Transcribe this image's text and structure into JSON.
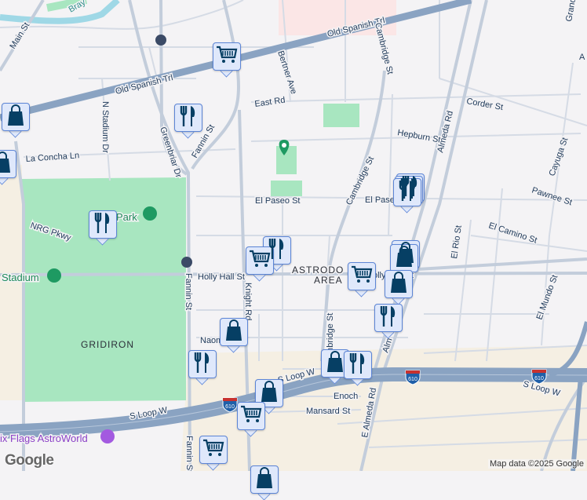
{
  "map": {
    "streets": {
      "main": "Main St",
      "bray": "Bray",
      "old_spanish_trl": "Old Spanish Trl",
      "old_spanish_trl_2": "Old Spanish Trl",
      "n_stadium": "N Stadium Dr",
      "greenbriar": "Greenbriar Dr",
      "fannin_1": "Fannin St",
      "fannin_2": "Fannin St",
      "fannin_3": "Fannin St",
      "bertner": "Bertner Ave",
      "east_rd": "East Rd",
      "cambridge_1": "Cambridge St",
      "cambridge_2": "Cambridge St",
      "cambridge_3": "Cambridge St",
      "corder": "Corder St",
      "hepburn": "Hepburn St",
      "almeda": "Almeda Rd",
      "almeda_2": "Alm",
      "e_almeda": "E Almeda Rd",
      "la_concha": "La Concha Ln",
      "el_paseo": "El Paseo St",
      "el_paseo_2": "El Pase",
      "nrg_pkwy": "NRG Pkwy",
      "holly_hall": "Holly Hall St",
      "holly_hall_2": "olly Hall St",
      "knight": "Knight Rd",
      "pawnee": "Pawnee St",
      "cayuga": "Cayuga St",
      "el_camino": "El Camino St",
      "el_rio": "El Rio St",
      "el_mundo": "El Mundo St",
      "naomi": "Naom",
      "s_loop_w_1": "S Loop W",
      "s_loop_w_2": "S Loop W",
      "s_loop_w_3": "S Loop W",
      "enoch": "Enoch",
      "mansard": "Mansard St",
      "grand": "Grand",
      "a": "A",
      "i610_1": "610",
      "i610_2": "610",
      "i610_3": "610"
    },
    "places": {
      "park": "Park",
      "stadium": "Stadium",
      "gridiron": "GRIDIRON",
      "astrodome_1": "ASTRODO",
      "astrodome_2": "AREA",
      "six_flags": "ix Flags AstroWorld"
    },
    "markers": [
      {
        "type": "grocery-cart-icon"
      },
      {
        "type": "shopping-bag-icon"
      },
      {
        "type": "shopping-bag-icon"
      },
      {
        "type": "restaurant-icon"
      },
      {
        "type": "restaurant-icon"
      },
      {
        "type": "restaurant-icon"
      },
      {
        "type": "restaurant-icon"
      },
      {
        "type": "restaurant-icon"
      },
      {
        "type": "shopping-bag-icon"
      },
      {
        "type": "shopping-bag-icon"
      },
      {
        "type": "restaurant-icon"
      },
      {
        "type": "grocery-cart-icon"
      },
      {
        "type": "grocery-cart-icon"
      },
      {
        "type": "shopping-bag-icon"
      },
      {
        "type": "restaurant-icon"
      },
      {
        "type": "shopping-bag-icon"
      },
      {
        "type": "restaurant-icon"
      },
      {
        "type": "shopping-bag-icon"
      },
      {
        "type": "restaurant-icon"
      },
      {
        "type": "shopping-bag-icon"
      },
      {
        "type": "grocery-cart-icon"
      },
      {
        "type": "grocery-cart-icon"
      },
      {
        "type": "shopping-bag-icon"
      }
    ],
    "colors": {
      "marker_fill": "#dfe8fb",
      "marker_border": "#5c85d6",
      "marker_icon": "#063f64",
      "park": "#a8e6c0",
      "highway": "#8aa3c2",
      "background": "#f4f3f5"
    },
    "attribution": "Map data ©2025 Google",
    "logo": "Google"
  }
}
